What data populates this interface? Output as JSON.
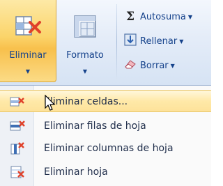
{
  "ribbon": {
    "eliminar": {
      "label": "Eliminar",
      "icon": "delete-cells-icon"
    },
    "formato": {
      "label": "Formato",
      "icon": "format-cells-icon"
    },
    "autosuma": {
      "label": "Autosuma",
      "icon": "sigma-icon"
    },
    "rellenar": {
      "label": "Rellenar",
      "icon": "fill-down-icon"
    },
    "borrar": {
      "label": "Borrar",
      "icon": "eraser-icon"
    }
  },
  "menu": {
    "items": [
      {
        "label": "Eliminar celdas...",
        "icon": "delete-cells-icon",
        "highlighted": true
      },
      {
        "label": "Eliminar filas de hoja",
        "icon": "delete-rows-icon",
        "highlighted": false
      },
      {
        "label": "Eliminar columnas de hoja",
        "icon": "delete-columns-icon",
        "highlighted": false
      },
      {
        "label": "Eliminar hoja",
        "icon": "delete-sheet-icon",
        "highlighted": false
      }
    ]
  },
  "colors": {
    "ribbon_text": "#15428b",
    "highlight": "#fde29a",
    "delete_red": "#e0412a"
  }
}
